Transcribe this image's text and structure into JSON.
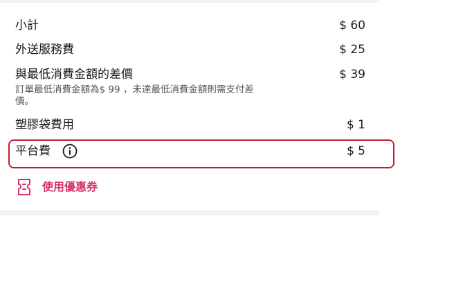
{
  "fees": {
    "subtotal": {
      "label": "小計",
      "amount": "$ 60"
    },
    "delivery": {
      "label": "外送服務費",
      "amount": "$ 25"
    },
    "min_order": {
      "label": "與最低消費金額的差價",
      "amount": "$ 39",
      "note": "訂單最低消費金額為$ 99 ，未達最低消費金額則需支付差價。"
    },
    "bag": {
      "label": "塑膠袋費用",
      "amount": "$ 1"
    },
    "platform": {
      "label": "平台費",
      "amount": "$ 5",
      "icon": "info-icon"
    }
  },
  "coupon": {
    "label": "使用優惠券",
    "icon": "coupon-ticket-icon",
    "color": "#d6336c"
  },
  "colors": {
    "highlight_border": "#c0202e",
    "text": "#1a1a1a",
    "note_text": "#555555"
  }
}
